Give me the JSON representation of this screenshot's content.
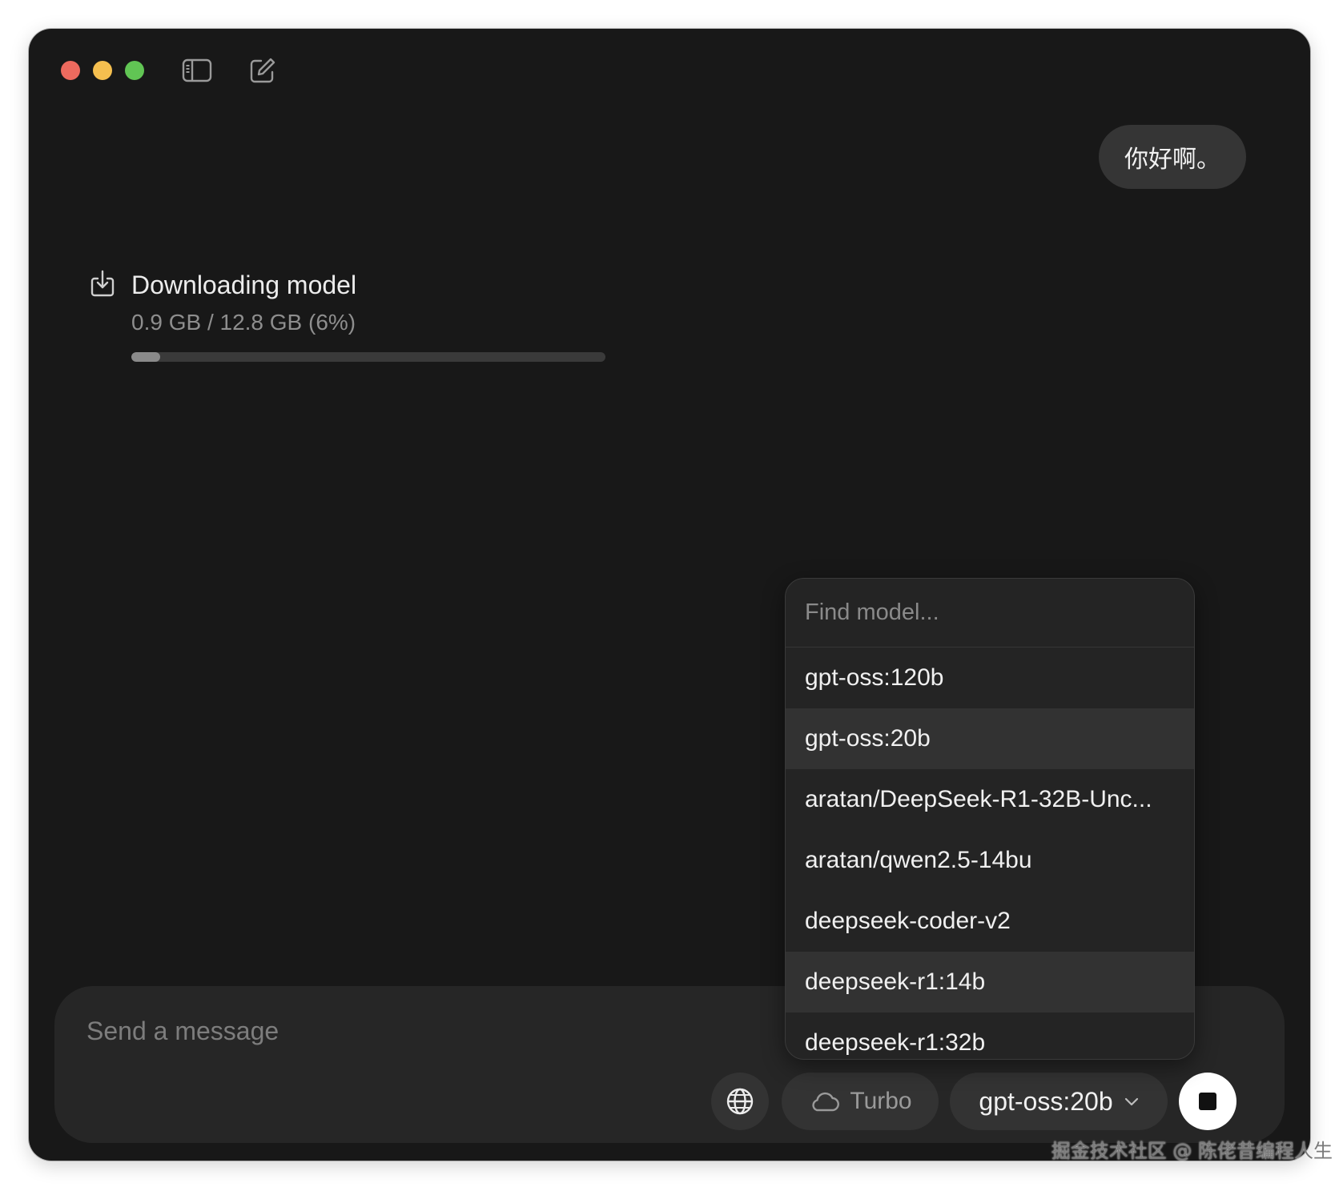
{
  "chat": {
    "user_message": "你好啊。"
  },
  "download": {
    "title": "Downloading model",
    "progress_text": "0.9 GB / 12.8 GB (6%)",
    "progress_percent": 6
  },
  "composer": {
    "placeholder": "Send a message",
    "turbo_label": "Turbo",
    "selected_model": "gpt-oss:20b"
  },
  "model_menu": {
    "search_placeholder": "Find model...",
    "items": [
      {
        "label": "gpt-oss:120b",
        "highlighted": false
      },
      {
        "label": "gpt-oss:20b",
        "highlighted": true
      },
      {
        "label": "aratan/DeepSeek-R1-32B-Unc...",
        "highlighted": false
      },
      {
        "label": "aratan/qwen2.5-14bu",
        "highlighted": false
      },
      {
        "label": "deepseek-coder-v2",
        "highlighted": false
      },
      {
        "label": "deepseek-r1:14b",
        "highlighted": true
      },
      {
        "label": "deepseek-r1:32b",
        "highlighted": false
      }
    ]
  },
  "watermark": "掘金技术社区 @ 陈佬昔编程人生",
  "icons": {
    "sidebar_toggle": "sidebar-toggle-icon",
    "new_chat": "compose-icon",
    "download": "download-icon",
    "web_search": "globe-icon",
    "turbo": "cloud-icon",
    "model_select": "chevron-down-icon",
    "stop": "stop-icon"
  },
  "colors": {
    "window_bg": "#181818",
    "bubble_bg": "#353535",
    "composer_bg": "#262626",
    "traffic_red": "#ed6a5e",
    "traffic_yellow": "#f5bf4f",
    "traffic_green": "#61c554"
  }
}
